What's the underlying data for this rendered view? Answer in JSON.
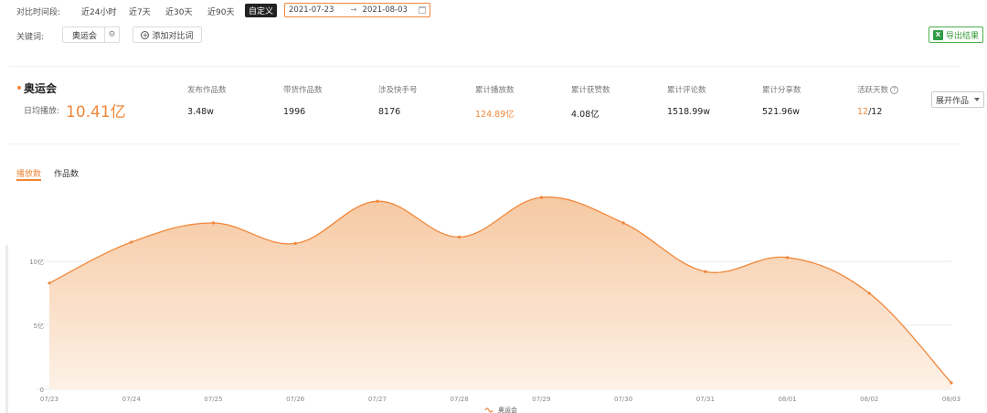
{
  "filters": {
    "range_label": "对比时间段:",
    "ranges": [
      "近24小时",
      "近7天",
      "近30天",
      "近90天",
      "自定义"
    ],
    "date_start": "2021-07-23",
    "date_end": "2021-08-03",
    "keyword_label": "关键词:",
    "keyword": "奥运会",
    "add_compare": "添加对比词",
    "export": "导出结果"
  },
  "summary": {
    "keyword": "奥运会",
    "avg_label": "日均播放:",
    "avg_value": "10.41亿",
    "stats": [
      {
        "label": "发布作品数",
        "value": "3.48w"
      },
      {
        "label": "带货作品数",
        "value": "1996"
      },
      {
        "label": "涉及快手号",
        "value": "8176"
      },
      {
        "label": "累计播放数",
        "value": "124.89亿"
      },
      {
        "label": "累计获赞数",
        "value": "4.08亿"
      },
      {
        "label": "累计评论数",
        "value": "1518.99w"
      },
      {
        "label": "累计分享数",
        "value": "521.96w"
      }
    ],
    "active_days_label": "活跃天数",
    "active_days": "12",
    "active_days_total": "/12",
    "expand_label": "展开作品"
  },
  "tabs": [
    "播放数",
    "作品数"
  ],
  "chart_data": {
    "type": "area",
    "x": [
      "07/23",
      "07/24",
      "07/25",
      "07/26",
      "07/27",
      "07/28",
      "07/29",
      "07/30",
      "07/31",
      "08/01",
      "08/02",
      "08/03"
    ],
    "series": [
      {
        "name": "奥运会",
        "values": [
          8.3,
          11.5,
          13.0,
          11.4,
          14.7,
          11.9,
          15.0,
          13.0,
          9.2,
          10.3,
          7.5,
          0.5
        ],
        "unit": "亿"
      }
    ],
    "yticks": [
      "0",
      "5亿",
      "10亿"
    ],
    "ylim": [
      0,
      15.5
    ],
    "grid": true,
    "legend": "bottom-center",
    "colors": {
      "line": "#f0873a",
      "area_top": "#f6c9a3",
      "area_bottom": "#fdf1e6"
    }
  }
}
